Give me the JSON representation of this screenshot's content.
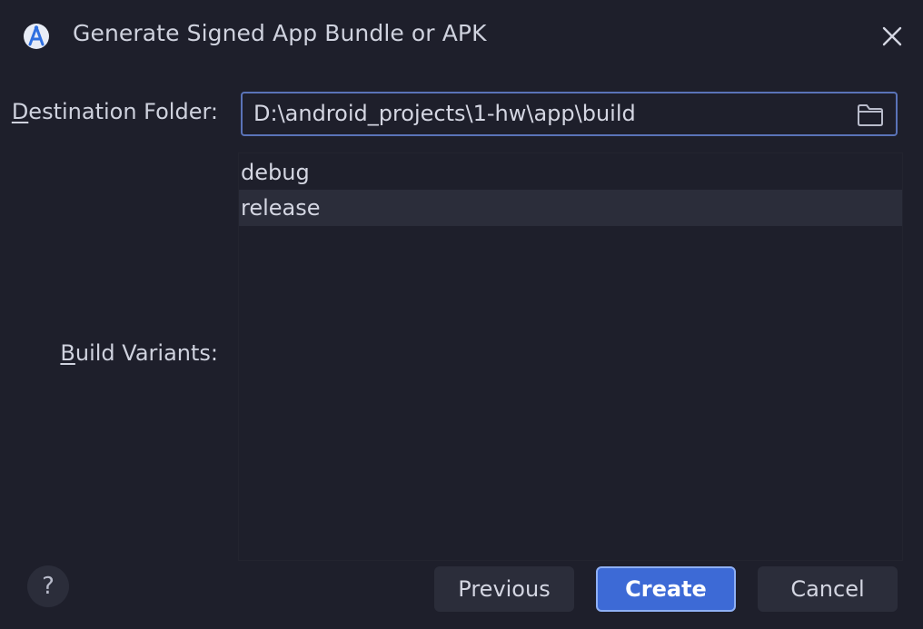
{
  "window": {
    "title": "Generate Signed App Bundle or APK",
    "app_icon": "android-studio-icon",
    "close_icon": "close-icon"
  },
  "form": {
    "destination_label_mnemonic": "D",
    "destination_label_rest": "estination Folder:",
    "destination_value": "D:\\android_projects\\1-hw\\app\\build",
    "folder_icon": "folder-icon",
    "variants_label_mnemonic": "B",
    "variants_label_rest": "uild Variants:",
    "variants": [
      {
        "label": "debug",
        "selected": false
      },
      {
        "label": "release",
        "selected": true
      }
    ]
  },
  "footer": {
    "help_label": "?",
    "previous_label": "Previous",
    "create_label": "Create",
    "cancel_label": "Cancel"
  },
  "colors": {
    "background": "#1e1f2b",
    "accent": "#3d6ad6",
    "field_border": "#5a73b8",
    "selected_row": "#2b2d3a"
  }
}
